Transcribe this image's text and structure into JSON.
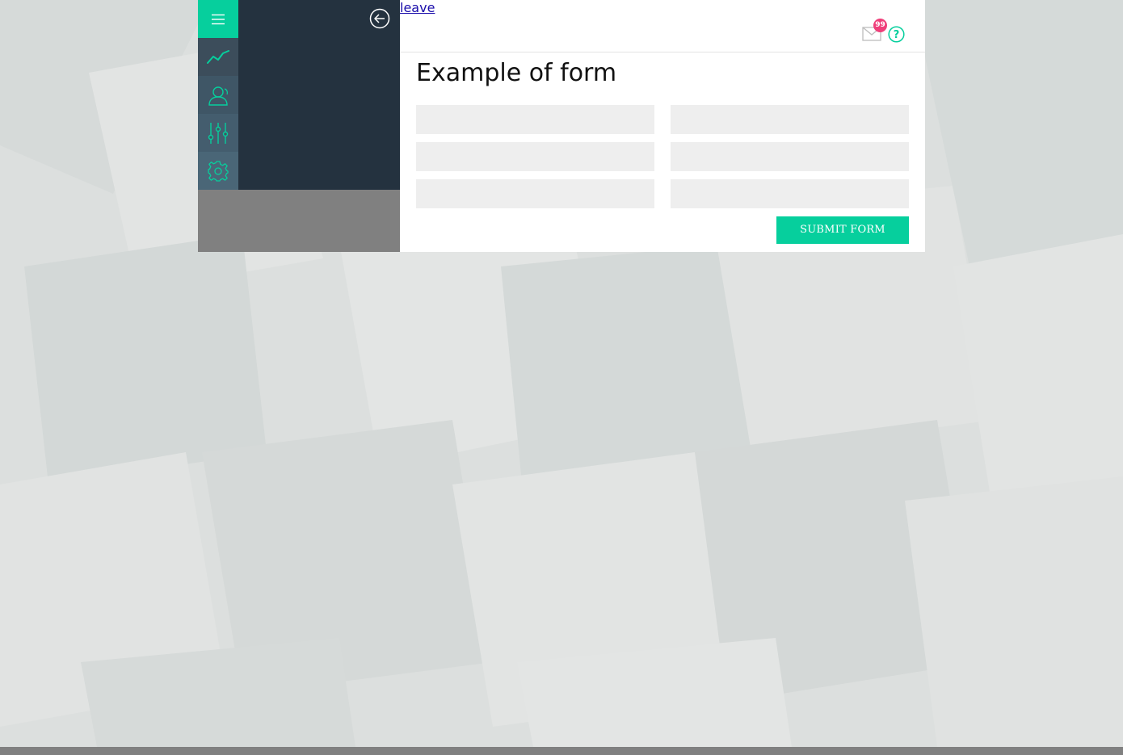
{
  "colors": {
    "accent": "#06cf9d",
    "sidebar_panel": "#24323f",
    "badge": "#ef3f7a",
    "field_bg": "#eeeeee",
    "link": "#1a0dab"
  },
  "sidebar": {
    "items": [
      {
        "icon": "menu-icon"
      },
      {
        "icon": "chart-line-icon"
      },
      {
        "icon": "user-icon"
      },
      {
        "icon": "sliders-icon"
      },
      {
        "icon": "gear-icon"
      }
    ],
    "back_icon": "arrow-left-circle-icon"
  },
  "header": {
    "leave_link": "leave",
    "mail_icon": "mail-icon",
    "mail_badge_count": "99",
    "help_icon": "help-icon"
  },
  "form": {
    "title": "Example of form",
    "fields": [
      {
        "value": "",
        "placeholder": ""
      },
      {
        "value": "",
        "placeholder": ""
      },
      {
        "value": "",
        "placeholder": ""
      },
      {
        "value": "",
        "placeholder": ""
      },
      {
        "value": "",
        "placeholder": ""
      },
      {
        "value": "",
        "placeholder": ""
      }
    ],
    "submit_label": "SUBMIT FORM"
  }
}
